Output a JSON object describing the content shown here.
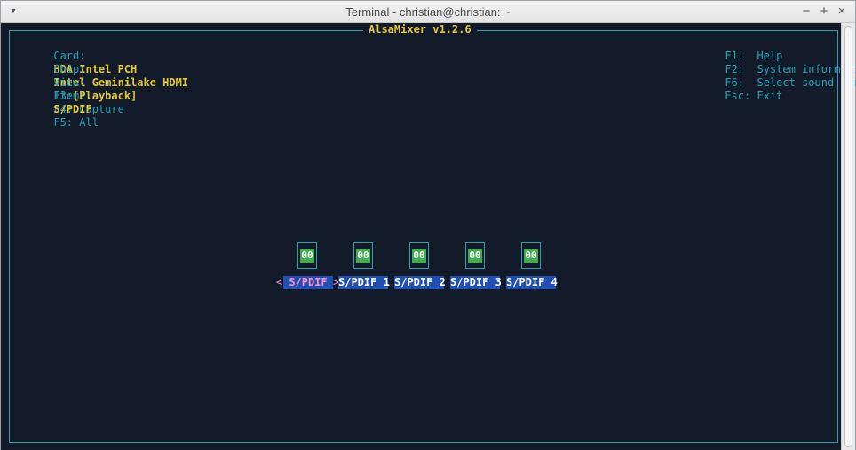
{
  "window": {
    "title": "Terminal - christian@christian: ~",
    "menu_glyph": "▾",
    "minimize_glyph": "−",
    "maximize_glyph": "+",
    "close_glyph": "×"
  },
  "mixer": {
    "title": "AlsaMixer v1.2.6",
    "card_label": "Card:",
    "card_value": "HDA Intel PCH",
    "chip_label": "Chip:",
    "chip_value": "Intel Geminilake HDMI",
    "view_label": "View:",
    "view_f3": "F3:",
    "view_playback": "[Playback]",
    "view_f4": "F4: Capture",
    "view_f5": "F5: All",
    "item_label": "Item:",
    "item_value": "S/PDIF",
    "help": [
      {
        "key": "F1:",
        "desc": "Help"
      },
      {
        "key": "F2:",
        "desc": "System information"
      },
      {
        "key": "F6:",
        "desc": "Select sound card"
      },
      {
        "key": "Esc:",
        "desc": "Exit"
      }
    ],
    "controls": [
      {
        "name": "S/PDIF",
        "state": "00"
      },
      {
        "name": "S/PDIF 1",
        "state": "00"
      },
      {
        "name": "S/PDIF 2",
        "state": "00"
      },
      {
        "name": "S/PDIF 3",
        "state": "00"
      },
      {
        "name": "S/PDIF 4",
        "state": "00"
      }
    ],
    "left_arrow": "<",
    "right_arrow": ">"
  }
}
